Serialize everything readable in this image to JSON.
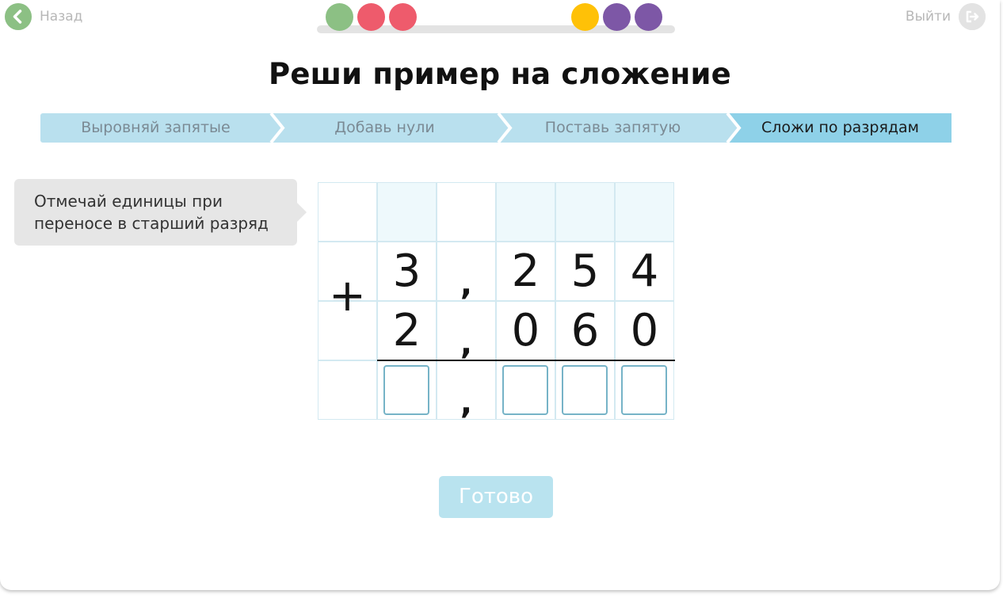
{
  "nav": {
    "back_label": "Назад",
    "exit_label": "Выйти"
  },
  "progress": {
    "dots": [
      {
        "color": "#8cc084"
      },
      {
        "color": "#ee5b6c"
      },
      {
        "color": "#ee5b6c"
      },
      {
        "color": "#ffc107"
      },
      {
        "color": "#7d57a6"
      },
      {
        "color": "#7d57a6"
      }
    ]
  },
  "title": "Реши пример на сложение",
  "steps": [
    {
      "label": "Выровняй запятые",
      "active": false
    },
    {
      "label": "Добавь нули",
      "active": false
    },
    {
      "label": "Поставь запятую",
      "active": false
    },
    {
      "label": "Сложи по разрядам",
      "active": true
    }
  ],
  "hint": "Отмечай единицы при переносе в старший разряд",
  "problem": {
    "operator": "+",
    "row1": [
      "3",
      ",",
      "2",
      "5",
      "4"
    ],
    "row2": [
      "2",
      ",",
      "0",
      "6",
      "0"
    ],
    "answer_comma": ","
  },
  "done_label": "Готово",
  "colors": {
    "step_inactive": "#b9e0ee",
    "step_active": "#8ed1e8",
    "answer_border": "#76b3c7",
    "done_bg": "#b9e3ef"
  }
}
